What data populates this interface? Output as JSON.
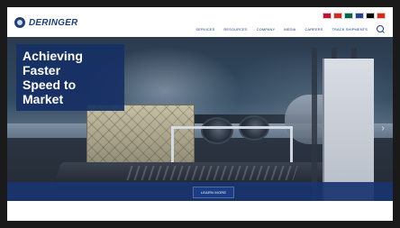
{
  "brand": {
    "name": "DERINGER",
    "primary": "#1f3f7d",
    "overlay_blue": "#173065"
  },
  "header": {
    "flags": [
      {
        "name": "us-flag",
        "color": "#c8102e"
      },
      {
        "name": "ca-flag",
        "color": "#d52b1e"
      },
      {
        "name": "mx-flag",
        "color": "#006847"
      },
      {
        "name": "nl-flag",
        "color": "#21468b"
      },
      {
        "name": "de-flag",
        "color": "#000000"
      },
      {
        "name": "cn-flag",
        "color": "#de2910"
      }
    ],
    "nav": [
      "SERVICES",
      "RESOURCES",
      "COMPANY",
      "MEDIA",
      "CAREERS",
      "TRACK SHIPMENTS"
    ],
    "search_icon": "search-icon"
  },
  "hero": {
    "headline_line1": "Achieving Faster",
    "headline_line2": "Speed to Market",
    "cta_label": "LEARN MORE",
    "next_icon": "chevron-right-icon"
  }
}
